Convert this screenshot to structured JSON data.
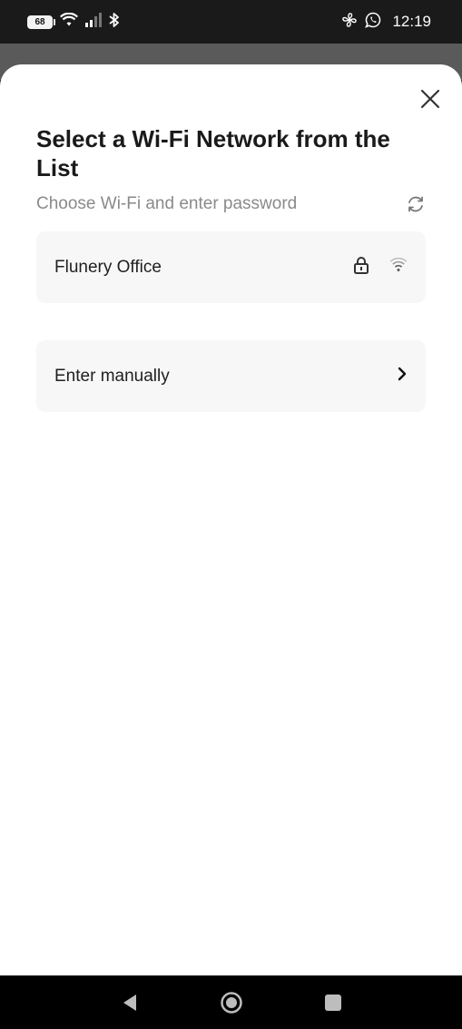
{
  "status_bar": {
    "battery_level": "68",
    "time": "12:19",
    "icons_left": [
      "battery-icon",
      "wifi-icon",
      "signal-icon",
      "bluetooth-icon"
    ],
    "icons_right": [
      "fan-icon",
      "whatsapp-icon"
    ]
  },
  "sheet": {
    "title": "Select a Wi-Fi Network from the List",
    "subtitle": "Choose Wi-Fi and enter password",
    "networks": [
      {
        "name": "Flunery Office",
        "locked": true,
        "signal_icon": "wifi-signal-icon"
      }
    ],
    "manual_entry_label": "Enter manually"
  },
  "nav_bar": {
    "buttons": [
      "back-button",
      "home-button",
      "recents-button"
    ]
  },
  "colors": {
    "sheet_bg": "#ffffff",
    "card_bg": "#f7f7f7",
    "title": "#1a1a1a",
    "subtitle": "#8a8a8a"
  }
}
